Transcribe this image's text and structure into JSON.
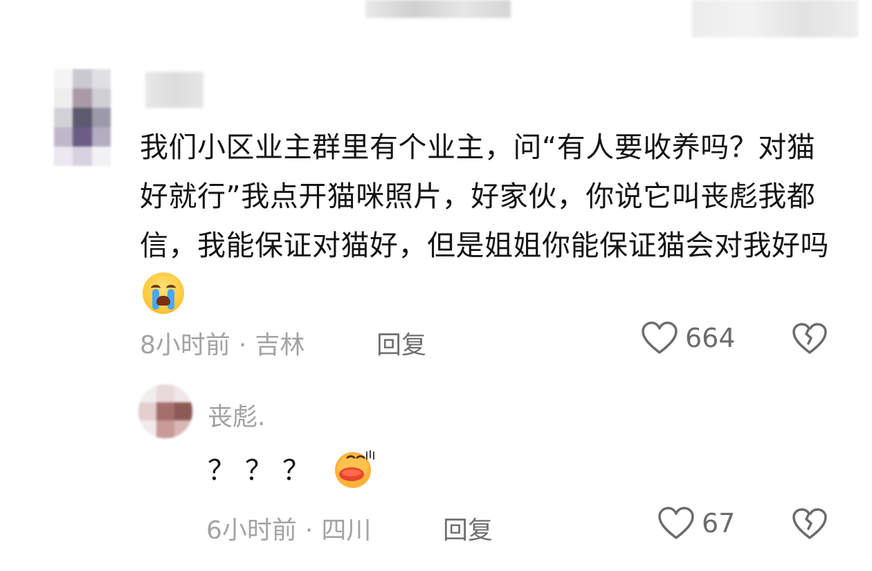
{
  "comment": {
    "text": "我们小区业主群里有个业主，问“有人要收养吗？对猫好就行”我点开猫咪照片，好家伙，你说它叫丧彪我都信，我能保证对猫好，但是姐姐你能保证猫会对我好吗",
    "emoji": "loudly-crying-face",
    "time": "8小时前",
    "separator": "·",
    "location": "吉林",
    "reply_label": "回复",
    "likes": "664"
  },
  "reply": {
    "username": "丧彪.",
    "text": "？？？",
    "emoji": "duck-lips-face",
    "time": "6小时前",
    "separator": "·",
    "location": "四川",
    "reply_label": "回复",
    "likes": "67"
  },
  "colors": {
    "meta_gray": "#a3a3a3",
    "reply_gray": "#6f6f6f",
    "text_dark": "#141414",
    "icon_gray": "#6b6b6b"
  }
}
